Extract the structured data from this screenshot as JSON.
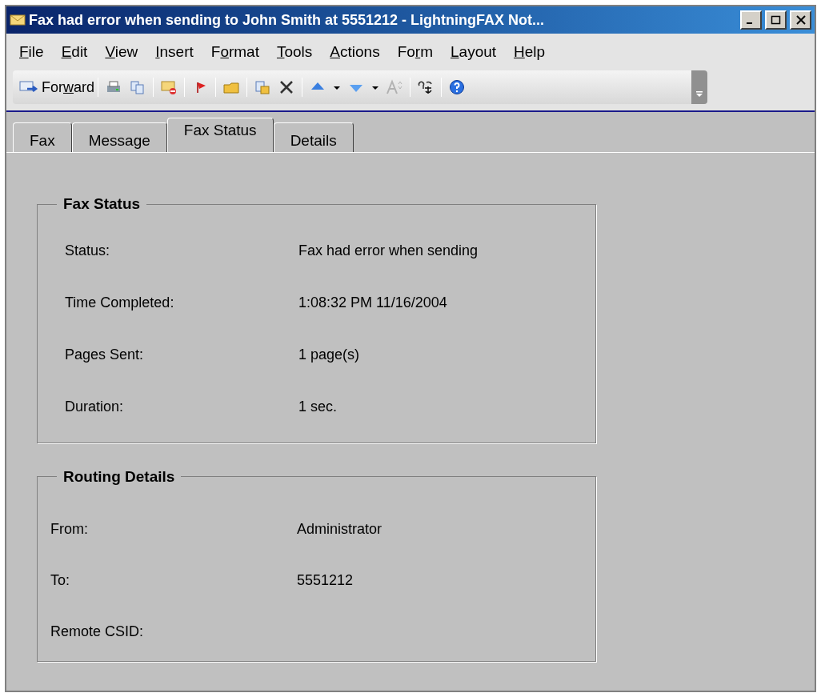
{
  "window": {
    "title": "Fax had error when sending to John Smith at 5551212 - LightningFAX Not..."
  },
  "menu": [
    {
      "key": "F",
      "post": "ile"
    },
    {
      "key": "E",
      "post": "dit"
    },
    {
      "key": "V",
      "post": "iew"
    },
    {
      "key": "I",
      "post": "nsert"
    },
    {
      "pre": "F",
      "key": "o",
      "post": "rmat"
    },
    {
      "key": "T",
      "post": "ools"
    },
    {
      "key": "A",
      "post": "ctions"
    },
    {
      "pre": "Fo",
      "key": "r",
      "post": "m"
    },
    {
      "key": "L",
      "post": "ayout"
    },
    {
      "key": "H",
      "post": "elp"
    }
  ],
  "toolbar": {
    "forward": {
      "pre": "For",
      "key": "w",
      "post": "ard"
    },
    "font_size_disabled": true
  },
  "tabs": [
    {
      "label": "Fax",
      "selected": false
    },
    {
      "label": "Message",
      "selected": false
    },
    {
      "label": "Fax Status",
      "selected": true
    },
    {
      "label": "Details",
      "selected": false
    }
  ],
  "groups": [
    {
      "title": "Fax Status",
      "rows": [
        {
          "label": "Status:",
          "value": "Fax had error when sending"
        },
        {
          "label": "Time Completed:",
          "value": "1:08:32 PM  11/16/2004"
        },
        {
          "label": "Pages Sent:",
          "value": "1 page(s)"
        },
        {
          "label": "Duration:",
          "value": "1 sec."
        }
      ]
    },
    {
      "title": "Routing Details",
      "rows": [
        {
          "label": "From:",
          "value": "Administrator"
        },
        {
          "label": "To:",
          "value": "5551212"
        },
        {
          "label": "Remote CSID:"
        }
      ]
    }
  ]
}
